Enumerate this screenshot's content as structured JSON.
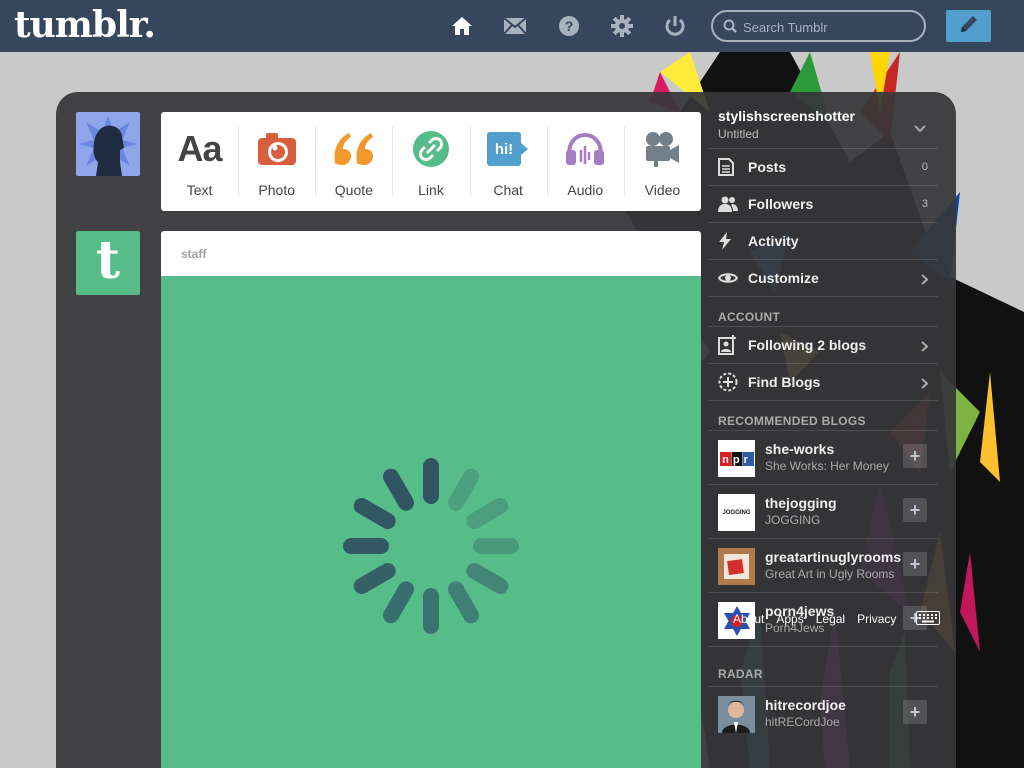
{
  "header": {
    "logo": "tumblr.",
    "search_placeholder": "Search Tumblr",
    "icons": [
      "home-icon",
      "mail-icon",
      "help-icon",
      "gear-icon",
      "power-icon"
    ],
    "accent": "#36465d",
    "compose_color": "#529ecc"
  },
  "post_types": [
    {
      "label": "Text",
      "glyph": "Aa",
      "color": "#444444"
    },
    {
      "label": "Photo",
      "color": "#d95e40"
    },
    {
      "label": "Quote",
      "color": "#f2992e"
    },
    {
      "label": "Link",
      "color": "#56bc8a"
    },
    {
      "label": "Chat",
      "glyph": "hi!",
      "color": "#529ecc"
    },
    {
      "label": "Audio",
      "color": "#a77dc2"
    },
    {
      "label": "Video",
      "color": "#748089"
    }
  ],
  "post": {
    "author": "staff",
    "media_color": "#56bc8a"
  },
  "sidebar": {
    "blog_name": "stylishscreenshotter",
    "blog_title": "Untitled",
    "items": [
      {
        "label": "Posts",
        "count": "0"
      },
      {
        "label": "Followers",
        "count": "3"
      },
      {
        "label": "Activity"
      },
      {
        "label": "Customize"
      }
    ],
    "account_heading": "ACCOUNT",
    "account_items": [
      {
        "label": "Following 2 blogs"
      },
      {
        "label": "Find Blogs"
      }
    ],
    "recommended_heading": "RECOMMENDED BLOGS",
    "recommended": [
      {
        "name": "she-works",
        "subtitle": "She Works: Her Money"
      },
      {
        "name": "thejogging",
        "subtitle": "JOGGING",
        "thumb_text": "JOGGING"
      },
      {
        "name": "greatartinuglyrooms",
        "subtitle": "Great Art in Ugly Rooms"
      },
      {
        "name": "porn4jews",
        "subtitle": "Porn4Jews"
      }
    ],
    "radar_heading": "RADAR",
    "radar": {
      "name": "hitrecordjoe",
      "subtitle": "hitRECordJoe"
    },
    "npr_thumb": "npr"
  },
  "footer": {
    "links": [
      "About",
      "Apps",
      "Legal",
      "Privacy"
    ]
  }
}
